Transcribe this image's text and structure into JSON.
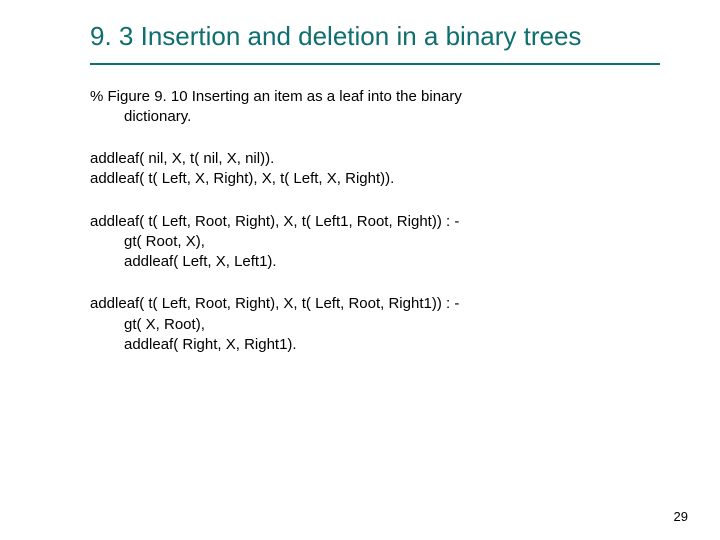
{
  "title": "9. 3 Insertion and deletion in a binary trees",
  "caption_line1": "% Figure 9. 10  Inserting an item as a leaf into the binary",
  "caption_line2": "dictionary.",
  "code1_l1": "addleaf( nil, X, t( nil, X, nil)).",
  "code1_l2": "addleaf( t( Left, X, Right), X, t( Left, X, Right)).",
  "code2_l1": "addleaf( t( Left, Root, Right), X, t( Left1, Root, Right)) : -",
  "code2_l2": "gt( Root, X),",
  "code2_l3": "addleaf( Left, X, Left1).",
  "code3_l1": "addleaf( t( Left, Root, Right), X, t( Left, Root, Right1)) : -",
  "code3_l2": "gt( X, Root),",
  "code3_l3": "addleaf( Right, X, Right1).",
  "page_number": "29"
}
